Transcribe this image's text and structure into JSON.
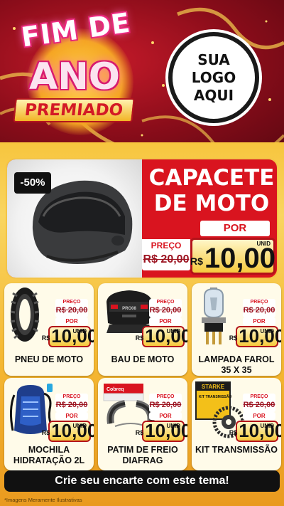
{
  "header": {
    "title_line1": "FIM DE",
    "title_line2": "ANO",
    "title_line3": "PREMIADO",
    "logo_lines": [
      "SUA",
      "LOGO",
      "AQUI"
    ]
  },
  "hero": {
    "discount": "-50%",
    "title_line1": "CAPACETE",
    "title_line2": "DE MOTO",
    "preco_label": "PREÇO",
    "old_price": "R$ 20,00",
    "por_label": "POR",
    "unit_label": "UNID",
    "currency": "R$",
    "new_price": "10,00"
  },
  "products": [
    {
      "name": "PNEU DE MOTO",
      "icon": "tire-icon",
      "preco_label": "PREÇO",
      "old_price": "R$ 20,00",
      "por_label": "POR",
      "unit_label": "UNID",
      "currency": "R$",
      "new_price": "10,00"
    },
    {
      "name": "BAU DE MOTO",
      "icon": "top-case-icon",
      "preco_label": "PREÇO",
      "old_price": "R$ 20,00",
      "por_label": "POR",
      "unit_label": "UNID",
      "currency": "R$",
      "new_price": "10,00"
    },
    {
      "name": "LAMPADA FAROL 35 X 35",
      "icon": "headlight-bulb-icon",
      "preco_label": "PREÇO",
      "old_price": "R$ 20,00",
      "por_label": "POR",
      "unit_label": "UNID",
      "currency": "R$",
      "new_price": "10,00"
    },
    {
      "name": "MOCHILA HIDRATAÇÃO 2L",
      "icon": "hydration-backpack-icon",
      "preco_label": "PREÇO",
      "old_price": "R$ 20,00",
      "por_label": "POR",
      "unit_label": "UNID",
      "currency": "R$",
      "new_price": "10,00"
    },
    {
      "name": "PATIM DE FREIO DIAFRAG",
      "icon": "brake-shoe-icon",
      "preco_label": "PREÇO",
      "old_price": "R$ 20,00",
      "por_label": "POR",
      "unit_label": "UNID",
      "currency": "R$",
      "new_price": "10,00"
    },
    {
      "name": "KIT TRANSMISSÃO",
      "icon": "transmission-kit-icon",
      "preco_label": "PREÇO",
      "old_price": "R$ 20,00",
      "por_label": "POR",
      "unit_label": "UNID",
      "currency": "R$",
      "new_price": "10,00"
    }
  ],
  "product_labels": {
    "top_case_brand": "PRO08",
    "brake_box_brand": "Cobreq",
    "kit_box_brand": "STARKE",
    "kit_box_text": "KIT TRANSMISSÃO"
  },
  "cta": {
    "label": "Crie seu encarte com este tema!"
  },
  "footnote": "*Imagens Meramente Ilustrativas",
  "colors": {
    "red": "#d9141f",
    "gold": "#f6ca3d",
    "dark_red": "#8e0f1c"
  }
}
